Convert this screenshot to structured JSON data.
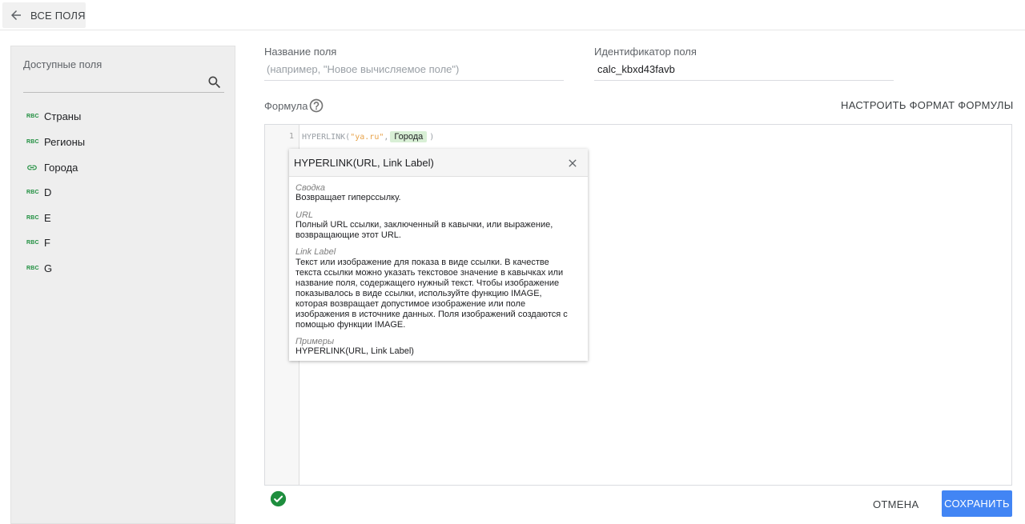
{
  "topbar": {
    "back_label": "ВСЕ ПОЛЯ",
    "back_icon": "arrow-left-icon"
  },
  "sidebar": {
    "title": "Доступные поля",
    "search_icon": "search-icon",
    "items": [
      {
        "label": "Страны",
        "type": "ABC"
      },
      {
        "label": "Регионы",
        "type": "ABC"
      },
      {
        "label": "Города",
        "type": "link"
      },
      {
        "label": "D",
        "type": "ABC"
      },
      {
        "label": "E",
        "type": "ABC"
      },
      {
        "label": "F",
        "type": "ABC"
      },
      {
        "label": "G",
        "type": "ABC"
      }
    ]
  },
  "field_name": {
    "label": "Название поля",
    "placeholder": "(например, \"Новое вычисляемое поле\")",
    "value": ""
  },
  "field_id": {
    "label": "Идентификатор поля",
    "value": "calc_kbxd43favb"
  },
  "formula": {
    "label": "Формула",
    "help_icon": "help-circle-icon",
    "format_button": "НАСТРОИТЬ ФОРМАТ ФОРМУЛЫ",
    "line_number": "1",
    "code_fn": "HYPERLINK(",
    "code_str": "\"ya.ru\"",
    "code_sep": ",",
    "code_chip": "Города",
    "code_end": ")"
  },
  "popup": {
    "title": "HYPERLINK(URL, Link Label)",
    "close_icon": "close-icon",
    "sections": [
      {
        "heading": "Сводка",
        "lines": [
          "Возвращает гиперссылку."
        ]
      },
      {
        "heading": "URL",
        "lines": [
          "Полный URL ссылки, заключенный в кавычки, или выражение,",
          "возвращающие этот URL."
        ]
      },
      {
        "heading": "Link Label",
        "lines": [
          "Текст или изображение для показа в виде ссылки. В качестве",
          "текста ссылки можно указать текстовое значение в кавычках или",
          "название поля, содержащего нужный текст. Чтобы изображение",
          "показывалось в виде ссылки, используйте функцию IMAGE,",
          "которая возвращает допустимое изображение или поле",
          "изображения в источнике данных. Поля изображений создаются с",
          "помощью функции IMAGE."
        ]
      },
      {
        "heading": "Примеры",
        "lines": [
          "HYPERLINK(URL, Link Label)"
        ]
      }
    ]
  },
  "footer": {
    "status_icon": "check-circle-icon",
    "cancel_label": "ОТМЕНА",
    "save_label": "СОХРАНИТЬ"
  },
  "colors": {
    "accent": "#4285f4",
    "success": "#1e8e3e",
    "chip": "#d8efd5"
  }
}
